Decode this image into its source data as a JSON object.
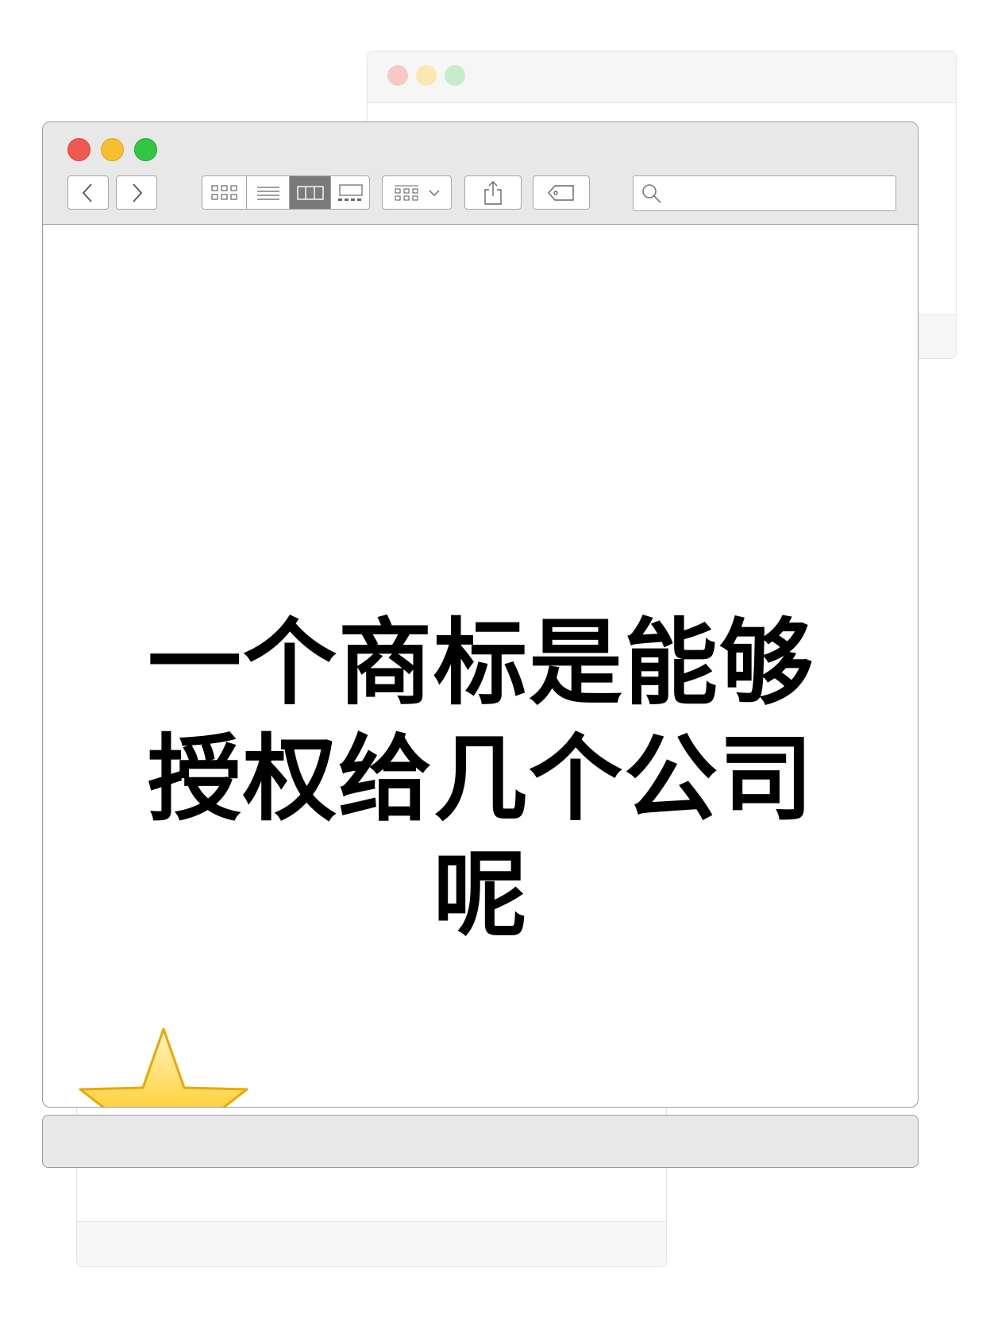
{
  "background_windows": {
    "back": {
      "traffic_colors": [
        "#f7c9c6",
        "#fbe7b3",
        "#c6ecc9"
      ]
    }
  },
  "window": {
    "traffic_lights": {
      "close": "#ee5a52",
      "minimize": "#f5bf2f",
      "zoom": "#2fc742"
    },
    "toolbar": {
      "back_icon": "chevron-left-icon",
      "forward_icon": "chevron-right-icon",
      "view_modes": [
        "icon-view",
        "list-view",
        "column-view",
        "gallery-view"
      ],
      "active_view": "column-view",
      "arrange_icon": "grid-arrange-icon",
      "share_icon": "share-icon",
      "tag_icon": "tag-icon",
      "search": {
        "value": "",
        "placeholder": ""
      }
    }
  },
  "content": {
    "headline_lines": [
      "一个商标是能够",
      "授权给几个公司",
      "呢"
    ],
    "decoration": "star-icon"
  }
}
